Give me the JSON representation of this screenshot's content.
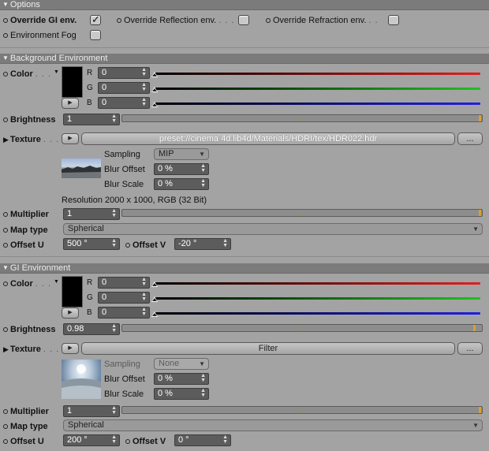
{
  "options": {
    "header": "Options",
    "override_gi": "Override GI env.",
    "override_gi_checked": true,
    "override_reflection": "Override Reflection env.",
    "override_reflection_dots": ". . .",
    "override_refraction": "Override Refraction env.",
    "override_refraction_dots": ". .",
    "environment_fog": "Environment Fog"
  },
  "background": {
    "header": "Background Environment",
    "color_label": "Color",
    "color_dots": ". . .",
    "r_label": "R",
    "g_label": "G",
    "b_label": "B",
    "r_value": "0",
    "g_value": "0",
    "b_value": "0",
    "brightness_label": "Brightness",
    "brightness_value": "1",
    "texture_label": "Texture",
    "texture_dots": ". . .",
    "texture_path": "preset://cinema 4d.lib4d/Materials/HDRI/tex/HDR022.hdr",
    "more_button": "...",
    "sampling_label": "Sampling",
    "sampling_value": "MIP",
    "blur_offset_label": "Blur Offset",
    "blur_offset_value": "0 %",
    "blur_scale_label": "Blur Scale",
    "blur_scale_value": "0 %",
    "resolution": "Resolution 2000 x 1000, RGB (32 Bit)",
    "multiplier_label": "Multiplier",
    "multiplier_value": "1",
    "map_type_label": "Map type",
    "map_type_value": "Spherical",
    "offset_u_label": "Offset U",
    "offset_u_value": "500 °",
    "offset_v_label": "Offset V",
    "offset_v_value": "-20 °"
  },
  "gi": {
    "header": "GI Environment",
    "color_label": "Color",
    "color_dots": ". . .",
    "r_label": "R",
    "g_label": "G",
    "b_label": "B",
    "r_value": "0",
    "g_value": "0",
    "b_value": "0",
    "brightness_label": "Brightness",
    "brightness_value": "0.98",
    "texture_label": "Texture",
    "texture_dots": ". . .",
    "texture_path": "Filter",
    "more_button": "...",
    "sampling_label": "Sampling",
    "sampling_value": "None",
    "blur_offset_label": "Blur Offset",
    "blur_offset_value": "0 %",
    "blur_scale_label": "Blur Scale",
    "blur_scale_value": "0 %",
    "multiplier_label": "Multiplier",
    "multiplier_value": "1",
    "map_type_label": "Map type",
    "map_type_value": "Spherical",
    "offset_u_label": "Offset U",
    "offset_u_value": "200 °",
    "offset_v_label": "Offset V",
    "offset_v_value": "0 °"
  },
  "colors": {
    "red_channel": "#e02020",
    "green_channel": "#20c020",
    "blue_channel": "#2020e0",
    "swatch": "#000000",
    "accent": "#d9a030"
  },
  "icons": {
    "section_collapse": "triangle-down-icon",
    "texture_expand": "triangle-right-icon",
    "color_picker": "triangle-down-icon",
    "texture_arrow_button": "play-arrow-icon"
  }
}
